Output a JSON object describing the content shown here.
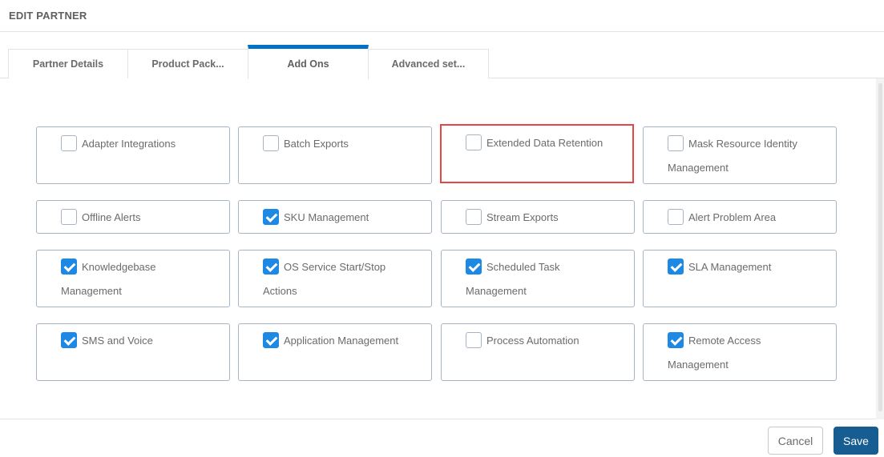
{
  "header": {
    "title": "EDIT PARTNER"
  },
  "tabs": [
    {
      "label": "Partner Details",
      "active": false
    },
    {
      "label": "Product Pack...",
      "active": false
    },
    {
      "label": "Add Ons",
      "active": true
    },
    {
      "label": "Advanced set...",
      "active": false
    }
  ],
  "colors": {
    "accent": "#0072c6",
    "checkbox_checked": "#1e88e5",
    "highlight_border": "#e84545",
    "save_button": "#175d91"
  },
  "addons": [
    {
      "line1": "Adapter Integrations",
      "line2": "",
      "checked": false,
      "highlighted": false
    },
    {
      "line1": "Batch Exports",
      "line2": "",
      "checked": false,
      "highlighted": false
    },
    {
      "line1": "Extended Data Retention",
      "line2": "",
      "checked": false,
      "highlighted": true
    },
    {
      "line1": "Mask Resource Identity",
      "line2": "Management",
      "checked": false,
      "highlighted": false
    },
    {
      "line1": "Offline Alerts",
      "line2": "",
      "checked": false,
      "highlighted": false
    },
    {
      "line1": "SKU Management",
      "line2": "",
      "checked": true,
      "highlighted": false
    },
    {
      "line1": "Stream Exports",
      "line2": "",
      "checked": false,
      "highlighted": false
    },
    {
      "line1": "Alert Problem Area",
      "line2": "",
      "checked": false,
      "highlighted": false
    },
    {
      "line1": "Knowledgebase",
      "line2": "Management",
      "checked": true,
      "highlighted": false
    },
    {
      "line1": "OS Service Start/Stop",
      "line2": "Actions",
      "checked": true,
      "highlighted": false
    },
    {
      "line1": "Scheduled Task",
      "line2": "Management",
      "checked": true,
      "highlighted": false
    },
    {
      "line1": "SLA Management",
      "line2": "",
      "checked": true,
      "highlighted": false
    },
    {
      "line1": "SMS and Voice",
      "line2": "",
      "checked": true,
      "highlighted": false
    },
    {
      "line1": "Application Management",
      "line2": "",
      "checked": true,
      "highlighted": false
    },
    {
      "line1": "Process Automation",
      "line2": "",
      "checked": false,
      "highlighted": false
    },
    {
      "line1": "Remote Access",
      "line2": "Management",
      "checked": true,
      "highlighted": false
    }
  ],
  "footer": {
    "cancel_label": "Cancel",
    "save_label": "Save"
  }
}
